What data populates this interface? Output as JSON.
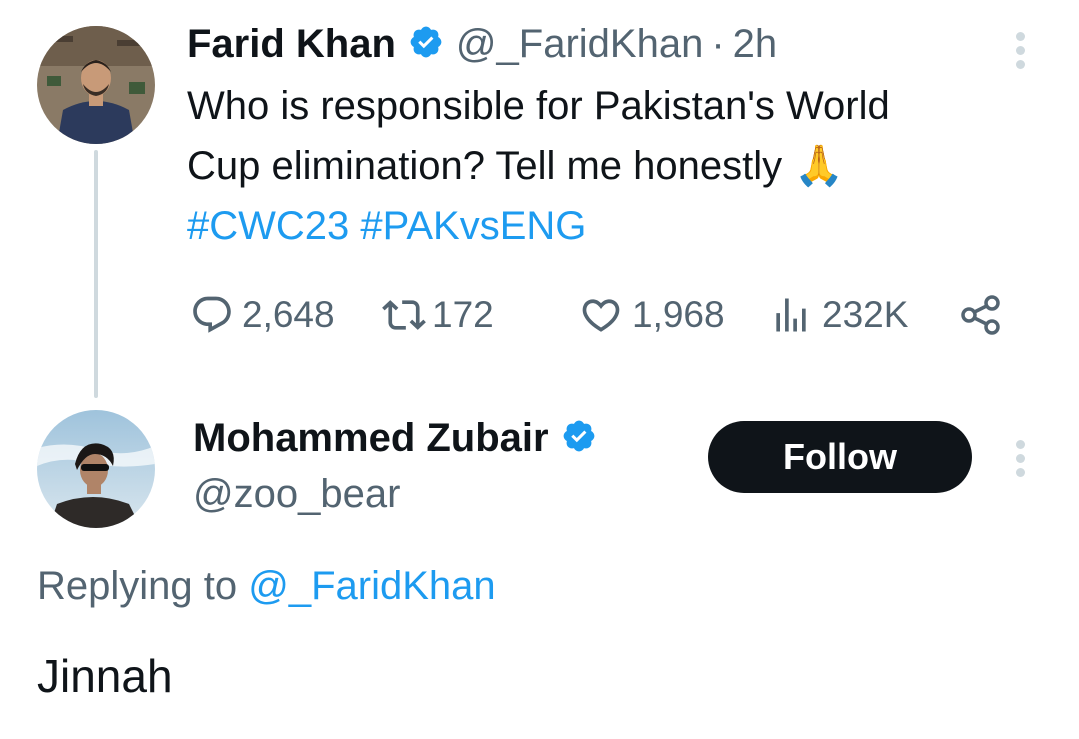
{
  "original_tweet": {
    "author_name": "Farid Khan",
    "handle": "@_FaridKhan",
    "separator": "·",
    "time": "2h",
    "text_line1": "Who is responsible for Pakistan's World",
    "text_line2": "Cup elimination? Tell me honestly",
    "emoji": "🙏",
    "hashtag1": "#CWC23",
    "hashtag2": "#PAKvsENG",
    "stats": {
      "replies": "2,648",
      "retweets": "172",
      "likes": "1,968",
      "views": "232K"
    }
  },
  "reply": {
    "author_name": "Mohammed Zubair",
    "handle": "@zoo_bear",
    "follow_label": "Follow",
    "replying_prefix": "Replying to",
    "replying_to": "@_FaridKhan",
    "text": "Jinnah"
  },
  "colors": {
    "accent": "#1d9bf0",
    "muted": "#536471",
    "text": "#0f1419",
    "thread_line": "#cfd9de"
  }
}
